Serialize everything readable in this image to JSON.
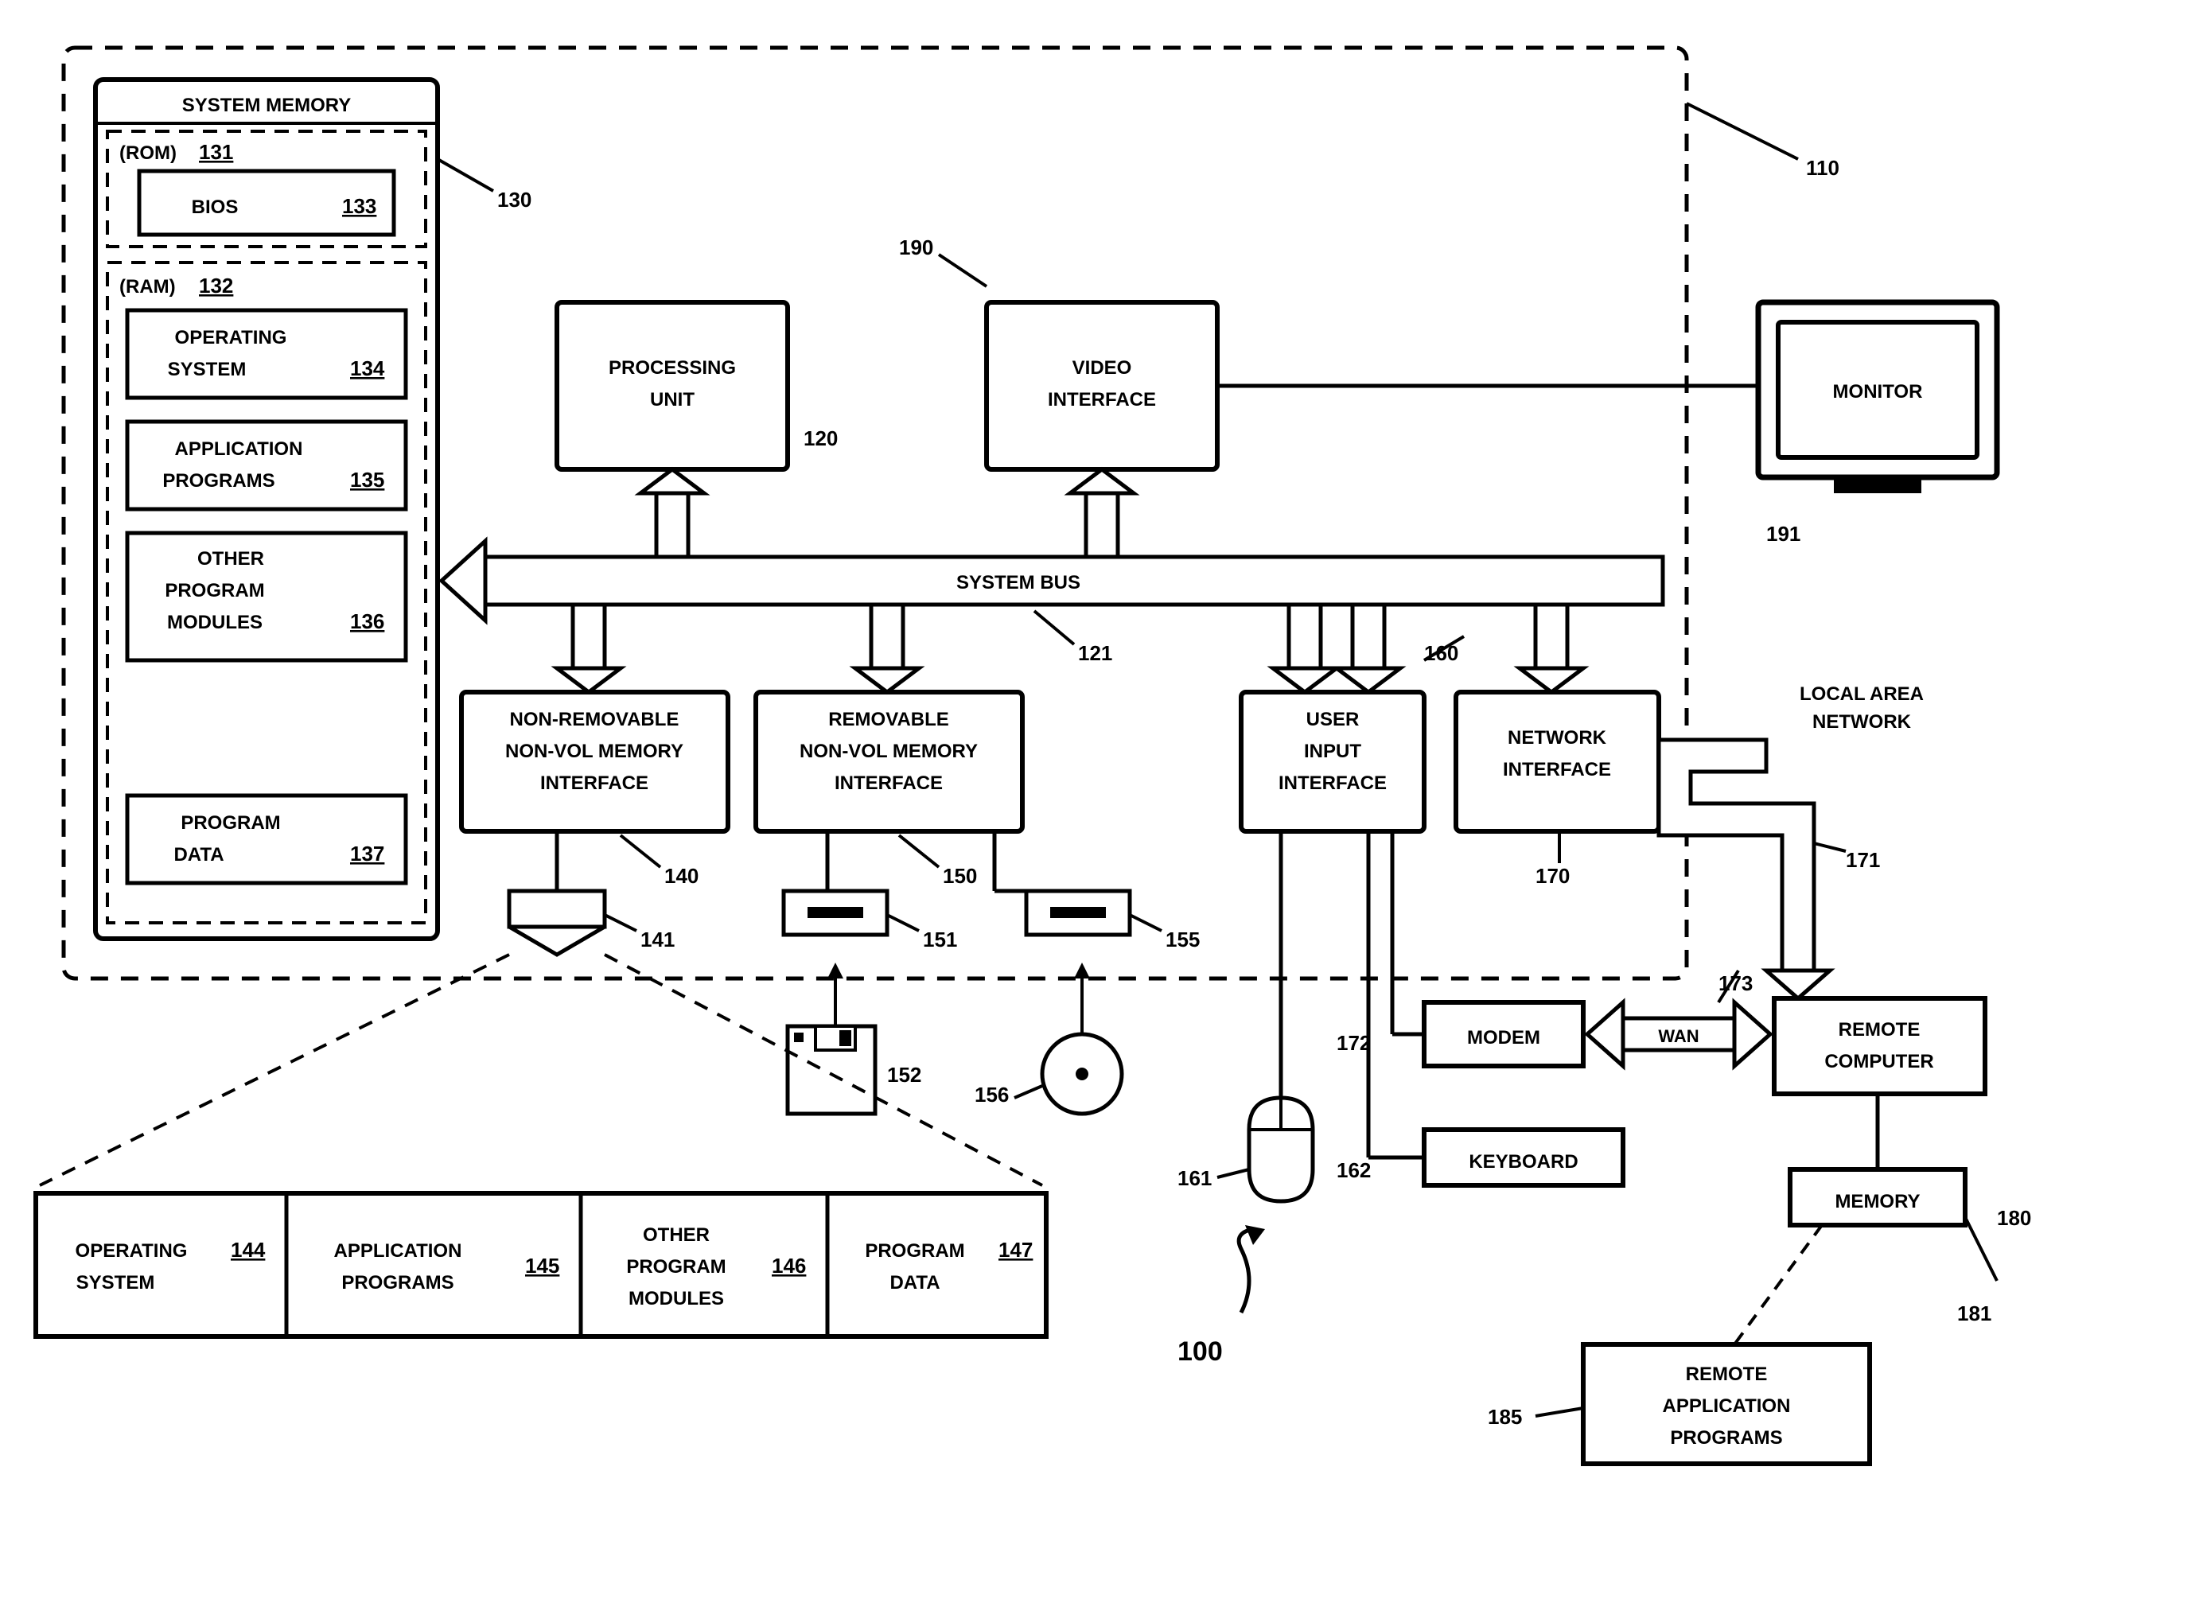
{
  "systemMemory": {
    "title": "SYSTEM MEMORY",
    "rom": {
      "label": "(ROM)",
      "num": "131"
    },
    "bios": {
      "label": "BIOS",
      "num": "133"
    },
    "ram": {
      "label": "(RAM)",
      "num": "132"
    },
    "os": {
      "label1": "OPERATING",
      "label2": "SYSTEM",
      "num": "134"
    },
    "apps": {
      "label1": "APPLICATION",
      "label2": "PROGRAMS",
      "num": "135"
    },
    "other": {
      "label1": "OTHER",
      "label2": "PROGRAM",
      "label3": "MODULES",
      "num": "136"
    },
    "pdata": {
      "label1": "PROGRAM",
      "label2": "DATA",
      "num": "137"
    },
    "outerNum": "130"
  },
  "procUnit": {
    "label1": "PROCESSING",
    "label2": "UNIT",
    "num": "120"
  },
  "video": {
    "label1": "VIDEO",
    "label2": "INTERFACE",
    "num": "190"
  },
  "monitor": {
    "label": "MONITOR",
    "num": "191"
  },
  "bus": {
    "label": "SYSTEM BUS",
    "num": "121"
  },
  "nonrem": {
    "l1": "NON-REMOVABLE",
    "l2": "NON-VOL MEMORY",
    "l3": "INTERFACE",
    "num": "140"
  },
  "rem": {
    "l1": "REMOVABLE",
    "l2": "NON-VOL MEMORY",
    "l3": "INTERFACE",
    "num": "150"
  },
  "userInput": {
    "l1": "USER",
    "l2": "INPUT",
    "l3": "INTERFACE",
    "num": "160"
  },
  "netIf": {
    "l1": "NETWORK",
    "l2": "INTERFACE",
    "num": "170"
  },
  "hdd": {
    "num": "141"
  },
  "floppyDrive": {
    "num": "151"
  },
  "cdDrive": {
    "num": "155"
  },
  "floppy": {
    "num": "152"
  },
  "cd": {
    "num": "156"
  },
  "mouse": {
    "num": "161"
  },
  "keyboard": {
    "label": "KEYBOARD",
    "num": "162"
  },
  "modem": {
    "label": "MODEM",
    "num": "172"
  },
  "wan": {
    "label": "WAN",
    "num": "173"
  },
  "lan": {
    "l1": "LOCAL AREA",
    "l2": "NETWORK",
    "num": "171"
  },
  "remote": {
    "l1": "REMOTE",
    "l2": "COMPUTER",
    "num": "180"
  },
  "memory": {
    "label": "MEMORY",
    "num": "181"
  },
  "remApps": {
    "l1": "REMOTE",
    "l2": "APPLICATION",
    "l3": "PROGRAMS",
    "num": "185"
  },
  "hddExpand": {
    "os": {
      "l1": "OPERATING",
      "l2": "SYSTEM",
      "num": "144"
    },
    "apps": {
      "l1": "APPLICATION",
      "l2": "PROGRAMS",
      "num": "145"
    },
    "other": {
      "l1": "OTHER",
      "l2": "PROGRAM",
      "l3": "MODULES",
      "num": "146"
    },
    "pdata": {
      "l1": "PROGRAM",
      "l2": "DATA",
      "num": "147"
    }
  },
  "figureNum": "100",
  "computerBoxNum": "110"
}
